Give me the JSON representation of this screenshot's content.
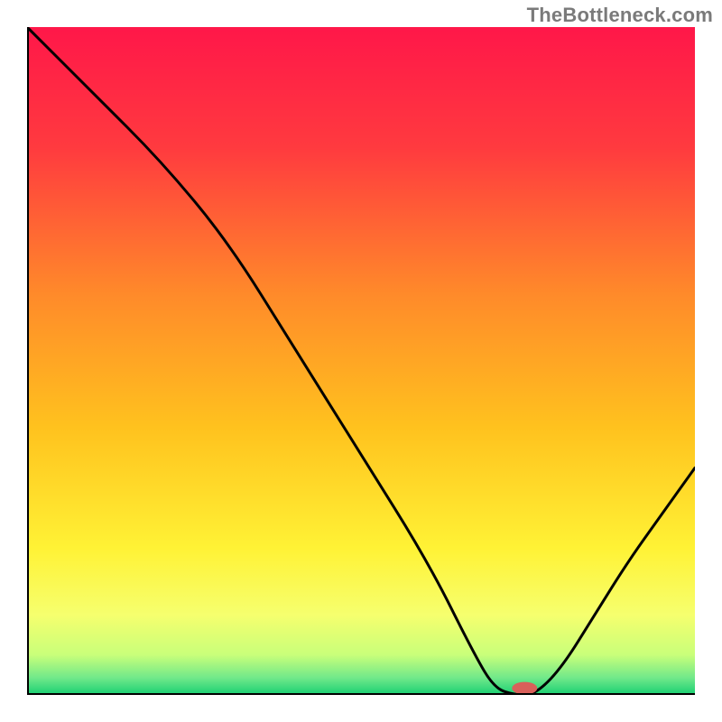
{
  "watermark": "TheBottleneck.com",
  "chart_data": {
    "type": "line",
    "title": "",
    "xlabel": "",
    "ylabel": "",
    "xlim": [
      0,
      100
    ],
    "ylim": [
      0,
      100
    ],
    "grid": false,
    "legend": false,
    "series": [
      {
        "name": "curve",
        "x": [
          0,
          10,
          20,
          30,
          40,
          50,
          60,
          67,
          70,
          73,
          76,
          80,
          85,
          90,
          95,
          100
        ],
        "values": [
          100,
          90,
          80,
          68,
          52,
          36,
          20,
          6,
          1,
          0,
          0,
          4,
          12,
          20,
          27,
          34
        ]
      }
    ],
    "marker": {
      "x": 74.5,
      "y": 1.0,
      "color": "#d9605a",
      "rx": 14,
      "ry": 7
    },
    "axis_color": "#000000",
    "background_gradient": {
      "stops": [
        {
          "offset": 0.0,
          "color": "#ff1749"
        },
        {
          "offset": 0.18,
          "color": "#ff3a3f"
        },
        {
          "offset": 0.4,
          "color": "#ff8a2a"
        },
        {
          "offset": 0.6,
          "color": "#ffc21e"
        },
        {
          "offset": 0.78,
          "color": "#fff235"
        },
        {
          "offset": 0.88,
          "color": "#f6ff6e"
        },
        {
          "offset": 0.94,
          "color": "#c9ff7a"
        },
        {
          "offset": 0.975,
          "color": "#6fe88a"
        },
        {
          "offset": 1.0,
          "color": "#18cf72"
        }
      ]
    }
  }
}
